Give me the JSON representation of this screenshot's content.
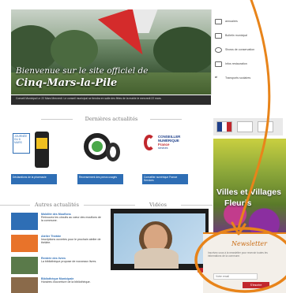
{
  "hero": {
    "title_line1": "Bienvenue sur le site officiel de",
    "title_line2": "Cinq-Mars-la-Pile"
  },
  "quick_menu": [
    {
      "label": "annuaires",
      "icon": "building-icon"
    },
    {
      "label": "Bulletin municipal",
      "icon": "monitor-icon"
    },
    {
      "label": "Shows de conservation",
      "icon": "heart-icon"
    },
    {
      "label": "Infos restauration",
      "icon": "document-icon"
    },
    {
      "label": "Transports scolaires",
      "icon": "arrows-icon"
    }
  ],
  "infobar": {
    "text": "Conseil Municipal Le 22 Mars Mercredi. Le conseil municipal se tiendra en salle des fêtes de la mairie le mercredi 22 mars."
  },
  "sections": {
    "dernieres": "Dernières actualités",
    "autres": "Autres actualités",
    "video": "Vidéos"
  },
  "news_cards": [
    {
      "caption": "Déclarations de la pharmacie",
      "badge": "JOURNÉE DU 8 MARS"
    },
    {
      "caption": "Recensement des pneus usagés",
      "badge": ""
    },
    {
      "caption": "Conseiller numérique France Services",
      "badge": ""
    }
  ],
  "conseiller": {
    "line1": "CONSEILLER",
    "line2": "NUMÉRIQUE",
    "line3": "France",
    "line4": "services"
  },
  "autres_list": [
    {
      "title": "Mobilité des Mouflons",
      "body": "Retrouvez les circuits au cœur des mouflons de la commune."
    },
    {
      "title": "Atelier Théâtre",
      "body": "Inscriptions ouvertes pour le prochain atelier de théâtre."
    },
    {
      "title": "Rentrée des livres",
      "body": "La bibliothèque propose de nouveaux livres."
    },
    {
      "title": "Bibliothèque Municipale",
      "body": "Horaires d'ouverture de la bibliothèque."
    }
  ],
  "fleuri": {
    "line1": "Villes et Villages",
    "line2": "Fleuris"
  },
  "newsletter": {
    "title": "Newsletter",
    "text": "Inscrivez-vous à la newsletter pour recevoir toutes les informations de la commune.",
    "input_placeholder": "Votre email",
    "button_label": "S'inscrire"
  },
  "colors": {
    "accent": "#c1272d",
    "link_blue": "#2e6eb5",
    "highlight_orange": "#e8841a"
  }
}
